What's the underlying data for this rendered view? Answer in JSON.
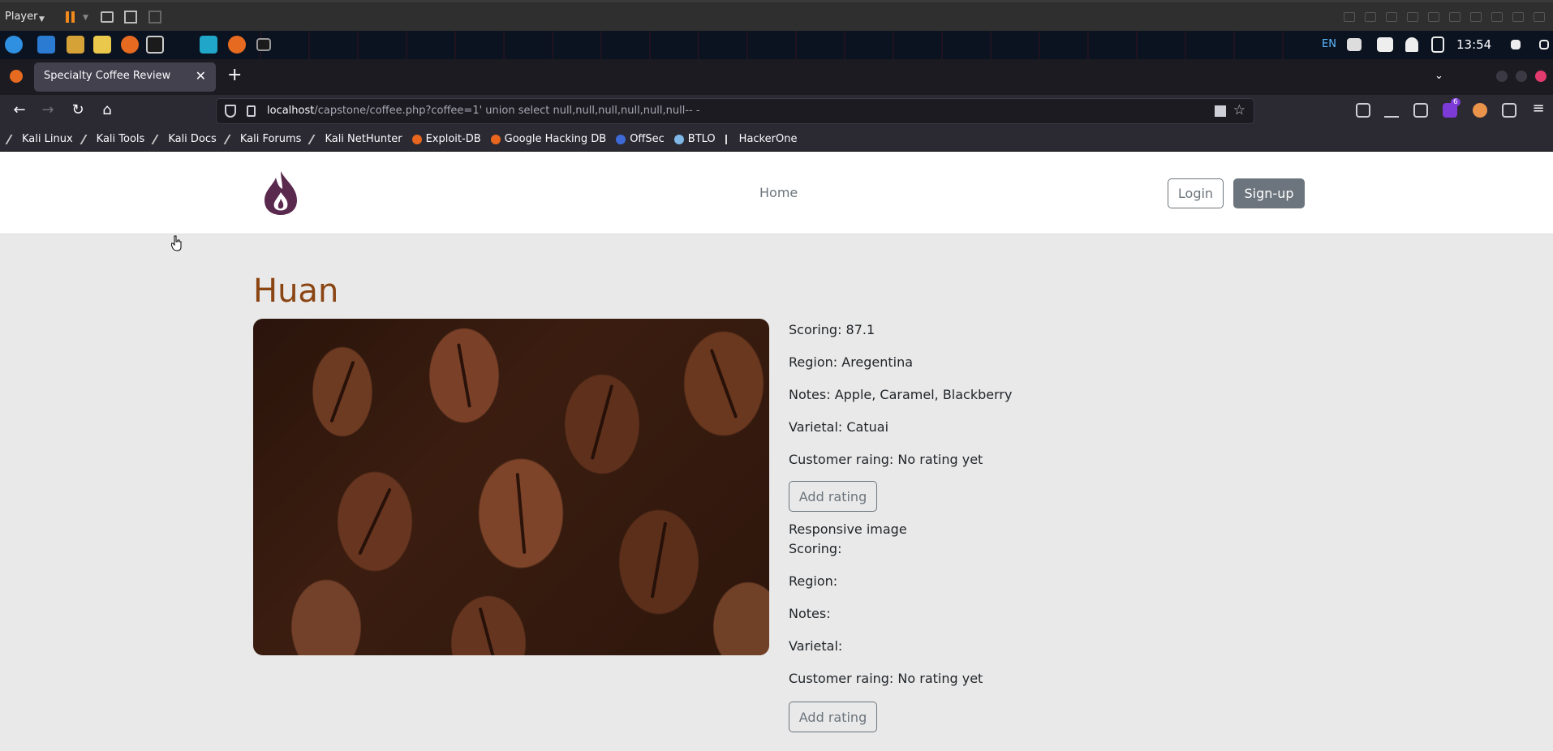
{
  "player": {
    "label": "Player"
  },
  "panel": {
    "lang": "EN",
    "clock": "13:54"
  },
  "browser": {
    "tab_title": "Specialty Coffee Review",
    "url_host": "localhost",
    "url_path": "/capstone/coffee.php?coffee=1' union select null,null,null,null,null,null-- -",
    "bookmarks": [
      "Kali Linux",
      "Kali Tools",
      "Kali Docs",
      "Kali Forums",
      "Kali NetHunter",
      "Exploit-DB",
      "Google Hacking DB",
      "OffSec",
      "BTLO",
      "HackerOne"
    ],
    "extension_badge": "6"
  },
  "site": {
    "nav_home": "Home",
    "login_label": "Login",
    "signup_label": "Sign-up"
  },
  "coffee": {
    "name": "Huan",
    "scoring": "Scoring: 87.1",
    "region": "Region: Aregentina",
    "notes": "Notes: Apple, Caramel, Blackberry",
    "varietal": "Varietal: Catuai",
    "customer_rating": "Customer raing: No rating yet",
    "add_rating": "Add rating"
  },
  "injected": {
    "image_alt": "Responsive image",
    "scoring": "Scoring:",
    "region": "Region:",
    "notes": "Notes:",
    "varietal": "Varietal:",
    "customer_rating": "Customer raing: No rating yet",
    "add_rating": "Add rating"
  },
  "colors": {
    "title": "#8b4513",
    "secondary": "#6c757d",
    "logo": "#5a2a4e"
  }
}
